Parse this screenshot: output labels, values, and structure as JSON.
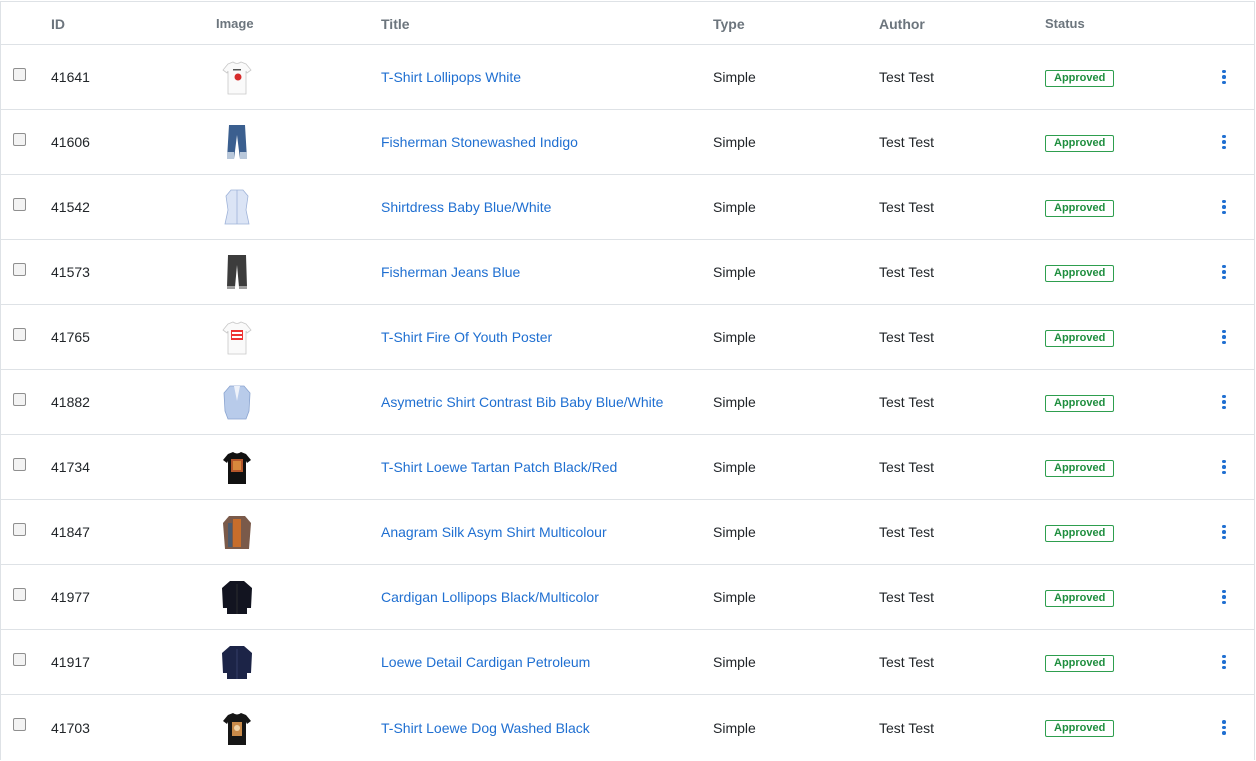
{
  "headers": {
    "id": "ID",
    "image": "Image",
    "title": "Title",
    "type": "Type",
    "author": "Author",
    "status": "Status"
  },
  "colors": {
    "link": "#1f6fd1",
    "approved": "#1e8e3e",
    "header_text": "#6c757d",
    "border": "#dee2e6"
  },
  "rows": [
    {
      "id": "41641",
      "title": "T-Shirt Lollipops White",
      "type": "Simple",
      "author": "Test Test",
      "status": "Approved",
      "image": "white-tshirt"
    },
    {
      "id": "41606",
      "title": "Fisherman Stonewashed Indigo",
      "type": "Simple",
      "author": "Test Test",
      "status": "Approved",
      "image": "blue-jeans"
    },
    {
      "id": "41542",
      "title": "Shirtdress Baby Blue/White",
      "type": "Simple",
      "author": "Test Test",
      "status": "Approved",
      "image": "shirtdress"
    },
    {
      "id": "41573",
      "title": "Fisherman Jeans Blue",
      "type": "Simple",
      "author": "Test Test",
      "status": "Approved",
      "image": "dark-jeans"
    },
    {
      "id": "41765",
      "title": "T-Shirt Fire Of Youth Poster",
      "type": "Simple",
      "author": "Test Test",
      "status": "Approved",
      "image": "poster-tshirt"
    },
    {
      "id": "41882",
      "title": "Asymetric Shirt Contrast Bib Baby Blue/White",
      "type": "Simple",
      "author": "Test Test",
      "status": "Approved",
      "image": "blue-shirt"
    },
    {
      "id": "41734",
      "title": "T-Shirt Loewe Tartan Patch Black/Red",
      "type": "Simple",
      "author": "Test Test",
      "status": "Approved",
      "image": "black-tshirt-patch"
    },
    {
      "id": "41847",
      "title": "Anagram Silk Asym Shirt Multicolour",
      "type": "Simple",
      "author": "Test Test",
      "status": "Approved",
      "image": "multicolour-shirt"
    },
    {
      "id": "41977",
      "title": "Cardigan Lollipops Black/Multicolor",
      "type": "Simple",
      "author": "Test Test",
      "status": "Approved",
      "image": "black-cardigan"
    },
    {
      "id": "41917",
      "title": "Loewe Detail Cardigan Petroleum",
      "type": "Simple",
      "author": "Test Test",
      "status": "Approved",
      "image": "navy-cardigan"
    },
    {
      "id": "41703",
      "title": "T-Shirt Loewe Dog Washed Black",
      "type": "Simple",
      "author": "Test Test",
      "status": "Approved",
      "image": "black-tshirt-dog"
    }
  ]
}
